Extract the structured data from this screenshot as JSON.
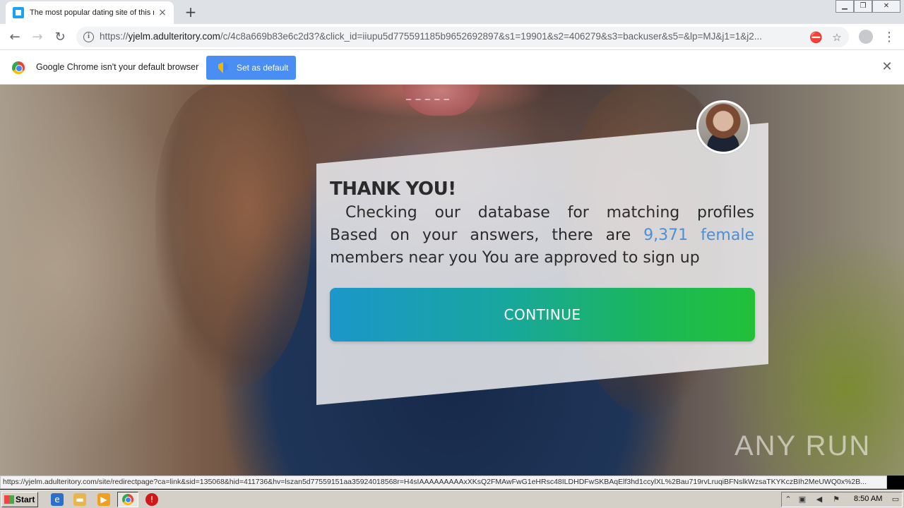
{
  "browser": {
    "tab": {
      "title": "The most popular dating site of this r",
      "close_icon": "×"
    },
    "new_tab_icon": "+",
    "window_controls": [
      "minimize",
      "restore",
      "close"
    ],
    "toolbar": {
      "back_icon": "←",
      "forward_icon": "→",
      "reload_icon": "↻",
      "url_scheme": "https://",
      "url_host": "yjelm.adulteritory.com",
      "url_path": "/c/4c8a669b83e6c2d3?&click_id=iiupu5d775591185b9652692897&s1=19901&s2=406279&s3=backuser&s5=&lp=MJ&j1=1&j2...",
      "star_icon": "☆",
      "menu_icon": "⋮"
    },
    "infobar": {
      "message": "Google Chrome isn't your default browser",
      "button_label": "Set as default",
      "close_icon": "✕"
    },
    "status_url": "https://yjelm.adulteritory.com/site/redirectpage?ca=link&sid=135068&hid=411736&hv=lszan5d77559151aa35924018568r=H4sIAAAAAAAAAxXKsQ2FMAwFwG1eHRsc48ILDHDFwSKBAqElf3hd1ccylXL%2Bau719rvLruqiBFNslkWzsaTKYKczBIh2MeUWQ0x%2B..."
  },
  "page": {
    "decor_dashes": "_ _ _ _ _",
    "title": "THANK YOU!",
    "body": {
      "line1": "Checking our database for matching profiles",
      "line2_prefix": "Based on your answers, there are ",
      "line2_highlight": "9,371 female",
      "line3": "members near you You are approved to sign up"
    },
    "cta_label": "CONTINUE",
    "watermark": "ANY RUN",
    "colors": {
      "highlight": "#4b8fd6",
      "cta_start": "#1b97c9",
      "cta_end": "#22c138"
    }
  },
  "taskbar": {
    "start_label": "Start",
    "clock": "8:50 AM"
  }
}
